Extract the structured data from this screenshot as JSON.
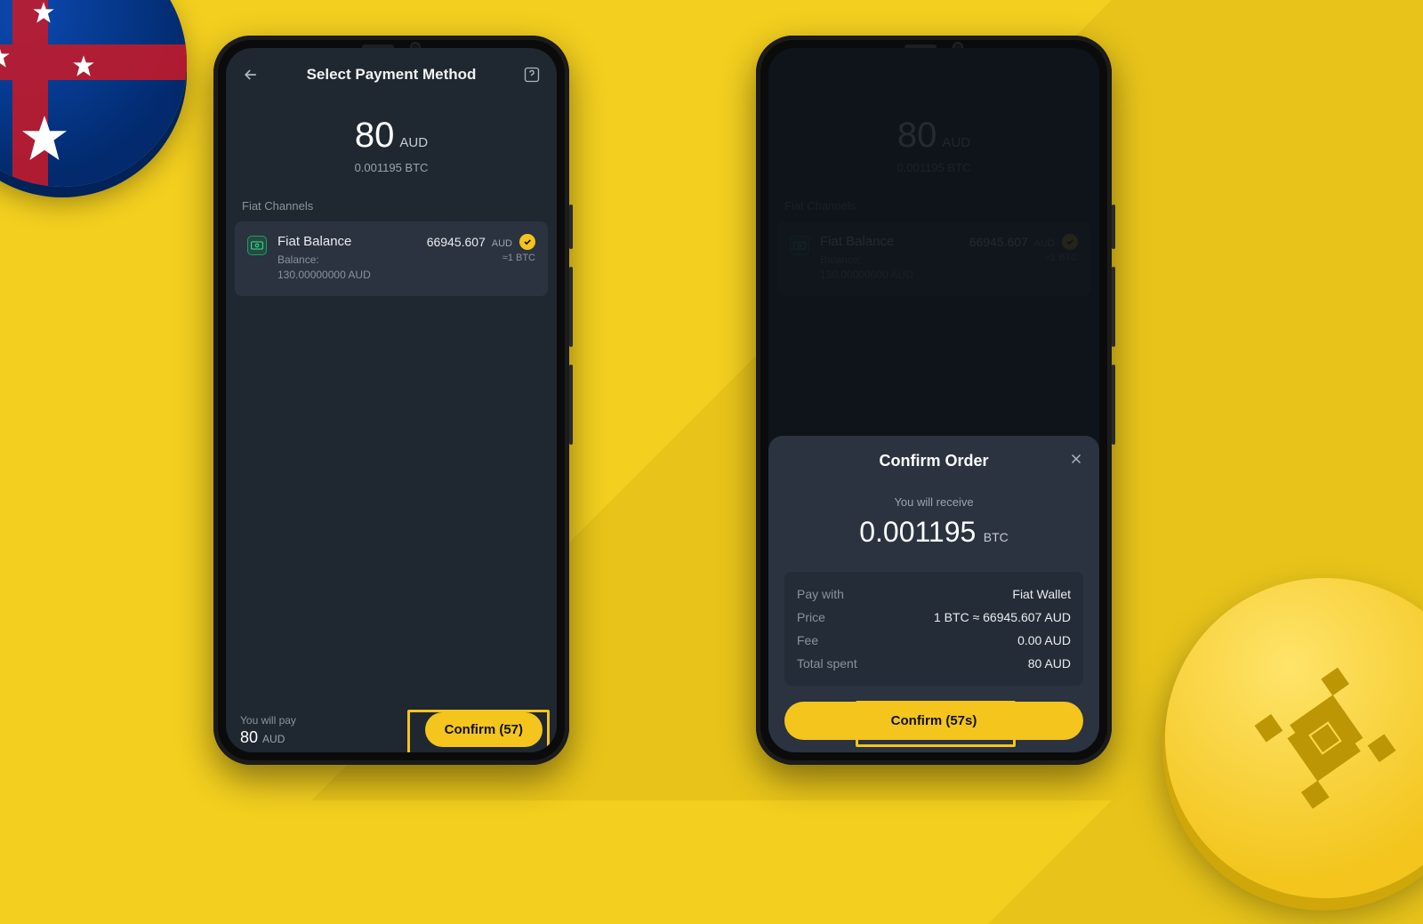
{
  "left": {
    "header": {
      "title": "Select Payment Method"
    },
    "amount": {
      "value": "80",
      "currency": "AUD",
      "converted": "0.001195 BTC"
    },
    "section_label": "Fiat Channels",
    "channel": {
      "name": "Fiat Balance",
      "balance_label": "Balance:",
      "balance_value": "130.00000000 AUD",
      "rate_value": "66945.607",
      "rate_currency": "AUD",
      "rate_note": "≈1 BTC"
    },
    "footer": {
      "pay_label": "You will pay",
      "pay_value": "80",
      "pay_currency": "AUD",
      "confirm_label": "Confirm (57)"
    }
  },
  "right": {
    "amount": {
      "value": "80",
      "currency": "AUD",
      "converted": "0.001195 BTC"
    },
    "section_label": "Fiat Channels",
    "channel": {
      "name": "Fiat Balance",
      "balance_label": "Balance:",
      "balance_value": "130.00000000 AUD",
      "rate_value": "66945.607",
      "rate_currency": "AUD",
      "rate_note": "≈1 BTC"
    },
    "sheet": {
      "title": "Confirm Order",
      "caption": "You will receive",
      "receive_value": "0.001195",
      "receive_unit": "BTC",
      "rows": {
        "pay_with": {
          "k": "Pay with",
          "v": "Fiat Wallet"
        },
        "price": {
          "k": "Price",
          "v": "1 BTC ≈ 66945.607 AUD"
        },
        "fee": {
          "k": "Fee",
          "v": "0.00 AUD"
        },
        "total": {
          "k": "Total spent",
          "v": "80 AUD"
        }
      },
      "confirm_label": "Confirm (57s)"
    }
  }
}
